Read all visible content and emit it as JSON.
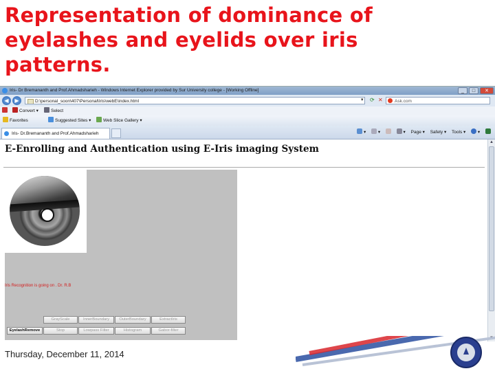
{
  "slide": {
    "title_lines": [
      "Representation of dominance of",
      "eyelashes and eyelids over iris",
      "patterns."
    ],
    "date": "Thursday, December 11, 2014"
  },
  "browser": {
    "window_title": "Iris- Dr Bremananth and Prof.Ahmadsharieh - Windows Internet Explorer provided by Sur University college - [Working Offline]",
    "address": "D:\\personal_soon\\407\\Personal\\Iris\\webE\\index.html",
    "search_placeholder": "Ask.com",
    "menu": {
      "convert": "Convert",
      "select": "Select"
    },
    "favorites": {
      "favorites": "Favorites",
      "suggested_sites": "Suggested Sites",
      "web_slice_gallery": "Web Slice Gallery"
    },
    "tab_label": "Iris- Dr.Bremananth and Prof.Ahmadsharieh",
    "commands": {
      "page": "Page",
      "safety": "Safety",
      "tools": "Tools"
    }
  },
  "page": {
    "heading": "E-Enrolling and Authentication using E-Iris imaging System",
    "status_message": "Iris Recognition is going on . Dr. R.B",
    "buttons": {
      "row1": [
        "GrayScale",
        "InnerBoundary",
        "OuterBoundary",
        "ExtractIris"
      ],
      "row2": [
        "EyelashRemove",
        "Stop",
        "Lowpass Filter",
        "Histogram",
        "Gabor-filter"
      ]
    }
  }
}
